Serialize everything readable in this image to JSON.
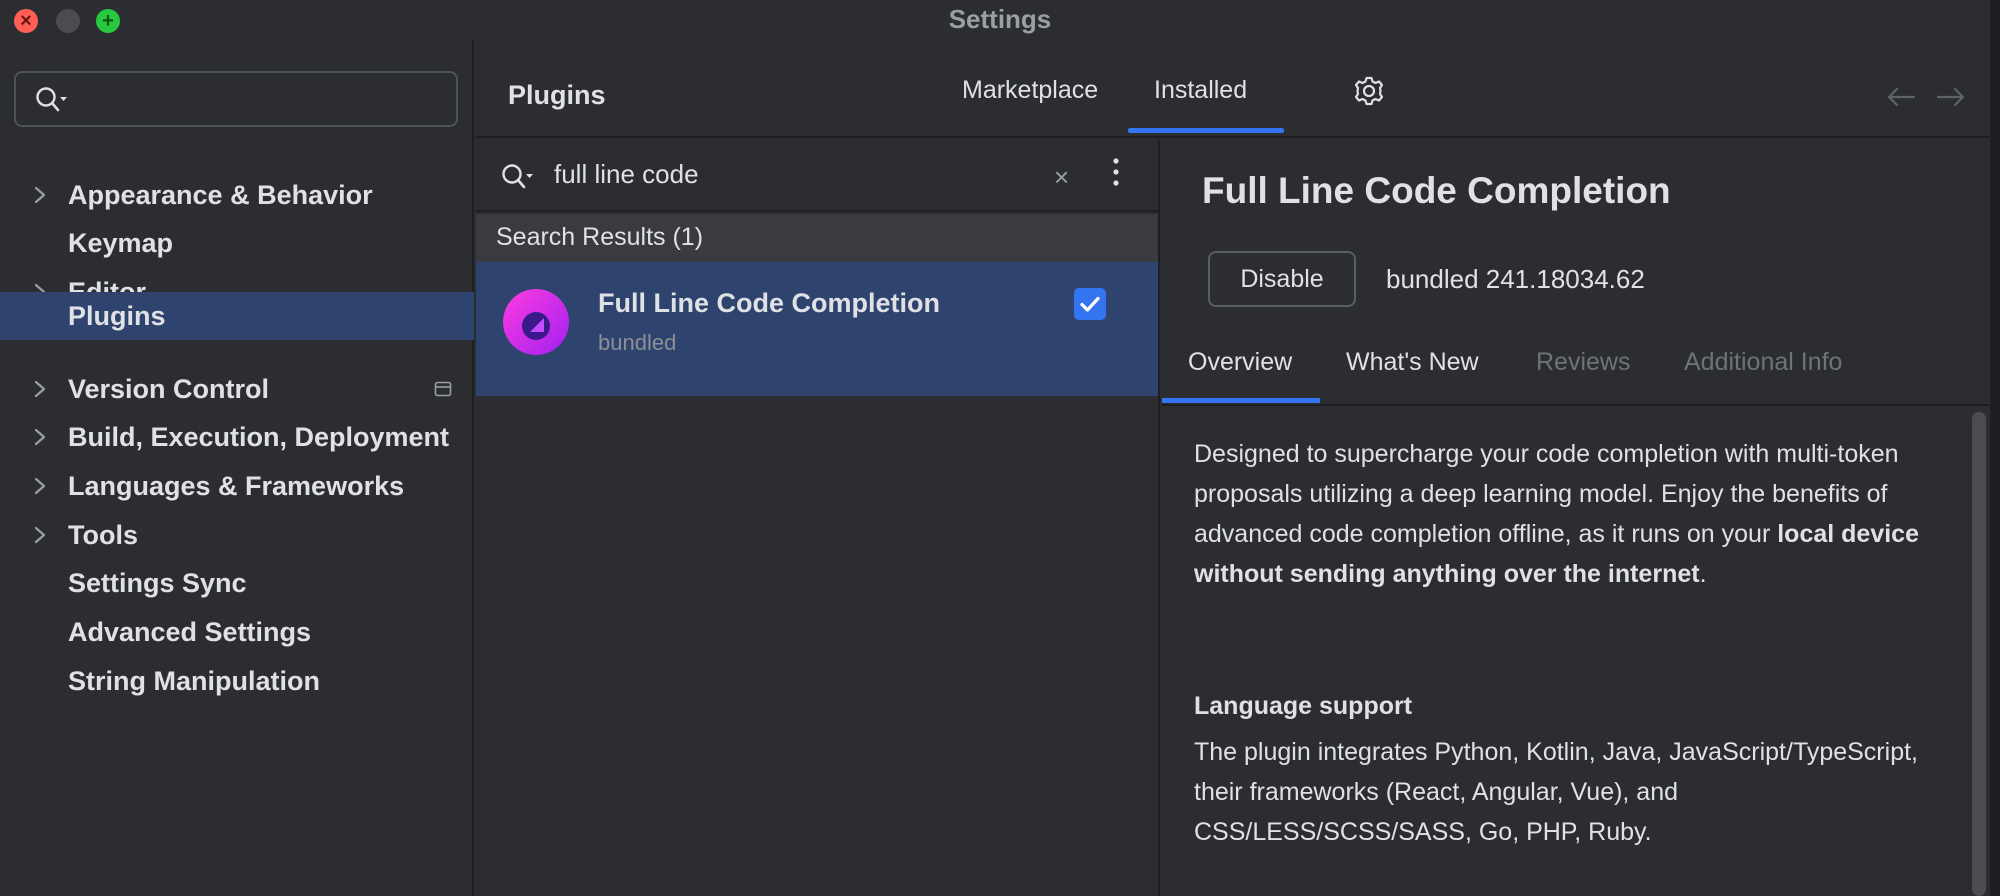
{
  "window": {
    "title": "Settings",
    "close_glyph": "×",
    "maximize_glyph": "+"
  },
  "sidebar": {
    "search": {
      "value": "",
      "placeholder": ""
    },
    "items": [
      {
        "label": "Appearance & Behavior",
        "expandable": true
      },
      {
        "label": "Keymap",
        "expandable": false
      },
      {
        "label": "Editor",
        "expandable": true
      },
      {
        "label": "Plugins",
        "expandable": false,
        "selected": true
      },
      {
        "label": "Version Control",
        "expandable": true,
        "icon": "project-scope-icon"
      },
      {
        "label": "Build, Execution, Deployment",
        "expandable": true
      },
      {
        "label": "Languages & Frameworks",
        "expandable": true
      },
      {
        "label": "Tools",
        "expandable": true
      },
      {
        "label": "Settings Sync",
        "expandable": false
      },
      {
        "label": "Advanced Settings",
        "expandable": false
      },
      {
        "label": "String Manipulation",
        "expandable": false
      }
    ]
  },
  "header": {
    "title": "Plugins",
    "tabs": [
      {
        "label": "Marketplace",
        "active": false
      },
      {
        "label": "Installed",
        "active": true
      }
    ],
    "gear_icon": "gear-icon",
    "back_icon": "arrow-left-icon",
    "forward_icon": "arrow-right-icon"
  },
  "plugin_list": {
    "search": {
      "value": "full line code",
      "clear_glyph": "×"
    },
    "results_header": "Search Results (1)",
    "items": [
      {
        "name": "Full Line Code Completion",
        "subtitle": "bundled",
        "enabled": true
      }
    ]
  },
  "details": {
    "title": "Full Line Code Completion",
    "disable_label": "Disable",
    "version": "bundled 241.18034.62",
    "tabs": [
      {
        "label": "Overview",
        "active": true,
        "enabled": true
      },
      {
        "label": "What's New",
        "active": false,
        "enabled": true
      },
      {
        "label": "Reviews",
        "active": false,
        "enabled": false
      },
      {
        "label": "Additional Info",
        "active": false,
        "enabled": false
      }
    ],
    "description": {
      "part1": "Designed to supercharge your code completion with multi-token proposals utilizing a deep learning model. Enjoy the benefits of advanced code completion offline, as it runs on your ",
      "bold": "local device without sending anything over the internet",
      "part2": "."
    },
    "language_support": {
      "heading": "Language support",
      "body": "The plugin integrates Python, Kotlin, Java, JavaScript/TypeScript, their frameworks (React, Angular, Vue), and CSS/LESS/SCSS/SASS, Go, PHP, Ruby."
    }
  },
  "colors": {
    "accent": "#3574f0",
    "selection": "#2e436e",
    "background": "#2b2d30",
    "divider": "#1e1f22"
  }
}
